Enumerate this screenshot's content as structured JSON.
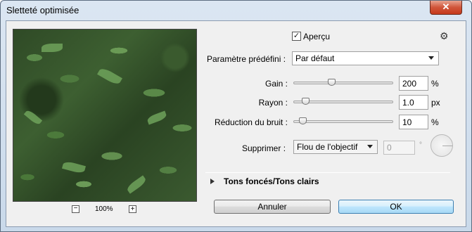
{
  "window": {
    "title": "Sletteté optimisée",
    "close_label": "✕"
  },
  "preview": {
    "zoom_level": "100%",
    "zoom_out_label": "−",
    "zoom_in_label": "+"
  },
  "apercu": {
    "label": "Aperçu",
    "checked": true,
    "check_glyph": "✓"
  },
  "settings_icon_glyph": "⚙",
  "preset": {
    "label": "Paramètre prédéfini :",
    "value": "Par défaut"
  },
  "params": {
    "gain": {
      "label": "Gain :",
      "value": "200",
      "unit": "%",
      "level": 0.38
    },
    "rayon": {
      "label": "Rayon :",
      "value": "1.0",
      "unit": "px",
      "level": 0.12
    },
    "bruit": {
      "label": "Réduction du bruit :",
      "value": "10",
      "unit": "%",
      "level": 0.09
    }
  },
  "supprimer": {
    "label": "Supprimer :",
    "value": "Flou de l'objectif",
    "angle": "0",
    "degree": "°"
  },
  "section": {
    "label": "Tons foncés/Tons clairs"
  },
  "buttons": {
    "cancel": "Annuler",
    "ok": "OK"
  }
}
